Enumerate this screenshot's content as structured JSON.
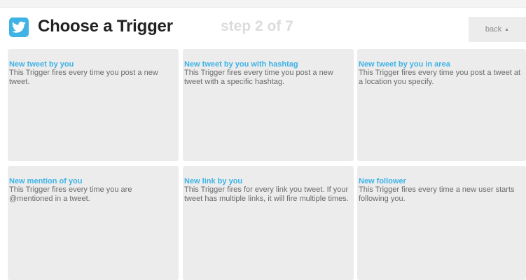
{
  "header": {
    "icon": "twitter-bird-icon",
    "title": "Choose a Trigger",
    "step": "step 2 of 7",
    "back_label": "back",
    "back_caret": "▲"
  },
  "colors": {
    "brand": "#3fb2e6",
    "card_title": "#3eb3e6",
    "card_bg": "#ececec"
  },
  "triggers": [
    {
      "title": "New tweet by you",
      "description": "This Trigger fires every time you post a new tweet."
    },
    {
      "title": "New tweet by you with hashtag",
      "description": "This Trigger fires every time you post a new tweet with a specific hashtag."
    },
    {
      "title": "New tweet by you in area",
      "description": "This Trigger fires every time you post a tweet at a location you specify."
    },
    {
      "title": "New mention of you",
      "description": "This Trigger fires every time you are @mentioned in a tweet."
    },
    {
      "title": "New link by you",
      "description": "This Trigger fires for every link you tweet. If your tweet has multiple links, it will fire multiple times."
    },
    {
      "title": "New follower",
      "description": "This Trigger fires every time a new user starts following you."
    }
  ]
}
